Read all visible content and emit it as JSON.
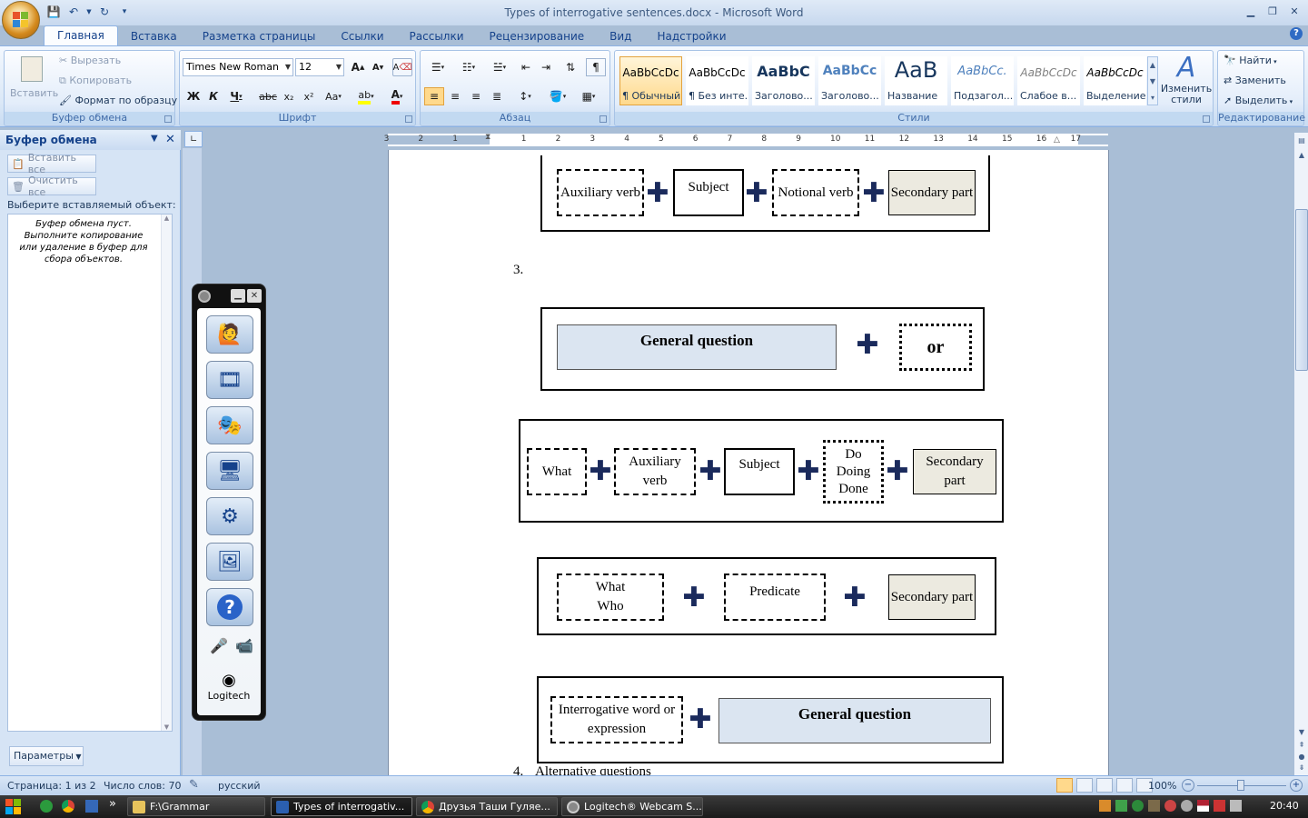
{
  "window": {
    "title": "Types of interrogative sentences.docx - Microsoft Word"
  },
  "tabs": [
    "Главная",
    "Вставка",
    "Разметка страницы",
    "Ссылки",
    "Рассылки",
    "Рецензирование",
    "Вид",
    "Надстройки"
  ],
  "ribbon": {
    "clipboard": {
      "label": "Буфер обмена",
      "paste": "Вставить",
      "cut": "Вырезать",
      "copy": "Копировать",
      "format_painter": "Формат по образцу"
    },
    "font": {
      "label": "Шрифт",
      "name": "Times New Roman",
      "size": "12"
    },
    "paragraph": {
      "label": "Абзац"
    },
    "styles": {
      "label": "Стили",
      "change": "Изменить стили",
      "items": [
        {
          "preview": "AaBbCcDc",
          "name": "¶ Обычный"
        },
        {
          "preview": "AaBbCcDc",
          "name": "¶ Без инте..."
        },
        {
          "preview": "AaBbC",
          "name": "Заголово..."
        },
        {
          "preview": "AaBbCc",
          "name": "Заголово..."
        },
        {
          "preview": "AaB",
          "name": "Название"
        },
        {
          "preview": "AaBbCc.",
          "name": "Подзагол..."
        },
        {
          "preview": "AaBbCcDc",
          "name": "Слабое в..."
        },
        {
          "preview": "AaBbCcDc",
          "name": "Выделение"
        }
      ]
    },
    "editing": {
      "label": "Редактирование",
      "find": "Найти",
      "replace": "Заменить",
      "select": "Выделить"
    }
  },
  "pane": {
    "title": "Буфер обмена",
    "paste_all": "Вставить все",
    "clear_all": "Очистить все",
    "choose": "Выберите вставляемый объект:",
    "empty": "Буфер обмена пуст. Выполните копирование или удаление в буфер для сбора объектов.",
    "options": "Параметры"
  },
  "ruler": {
    "numbers": [
      "3",
      "2",
      "1",
      "1",
      "2",
      "3",
      "4",
      "5",
      "6",
      "7",
      "8",
      "9",
      "10",
      "11",
      "12",
      "13",
      "14",
      "15",
      "16",
      "17"
    ]
  },
  "document": {
    "diagram1": {
      "b1": "Auxiliary verb",
      "b2": "Subject",
      "b3": "Notional verb",
      "b4": "Secondary part"
    },
    "item3": "3.",
    "diagram2": {
      "b1": "General question",
      "b2": "or"
    },
    "diagram3": {
      "b1": "What",
      "b2": "Auxiliary verb",
      "b3": "Subject",
      "b4": "Do Doing Done",
      "b5": "Secondary part"
    },
    "diagram4": {
      "b1": "What Who",
      "b2": "Predicate",
      "b3": "Secondary part"
    },
    "diagram5": {
      "b1": "Interrogative word or expression",
      "b2": "General question"
    },
    "item4": "4.",
    "item4_text": "Alternative questions"
  },
  "logitech": {
    "brand": "Logitech"
  },
  "status": {
    "page": "Страница: 1 из 2",
    "words": "Число слов: 70",
    "lang": "русский",
    "zoom": "100%"
  },
  "taskbar": {
    "items": [
      "F:\\Grammar",
      "Types of interrogativ...",
      "Друзья Таши Гуляе...",
      "Logitech® Webcam S..."
    ],
    "clock": "20:40"
  }
}
